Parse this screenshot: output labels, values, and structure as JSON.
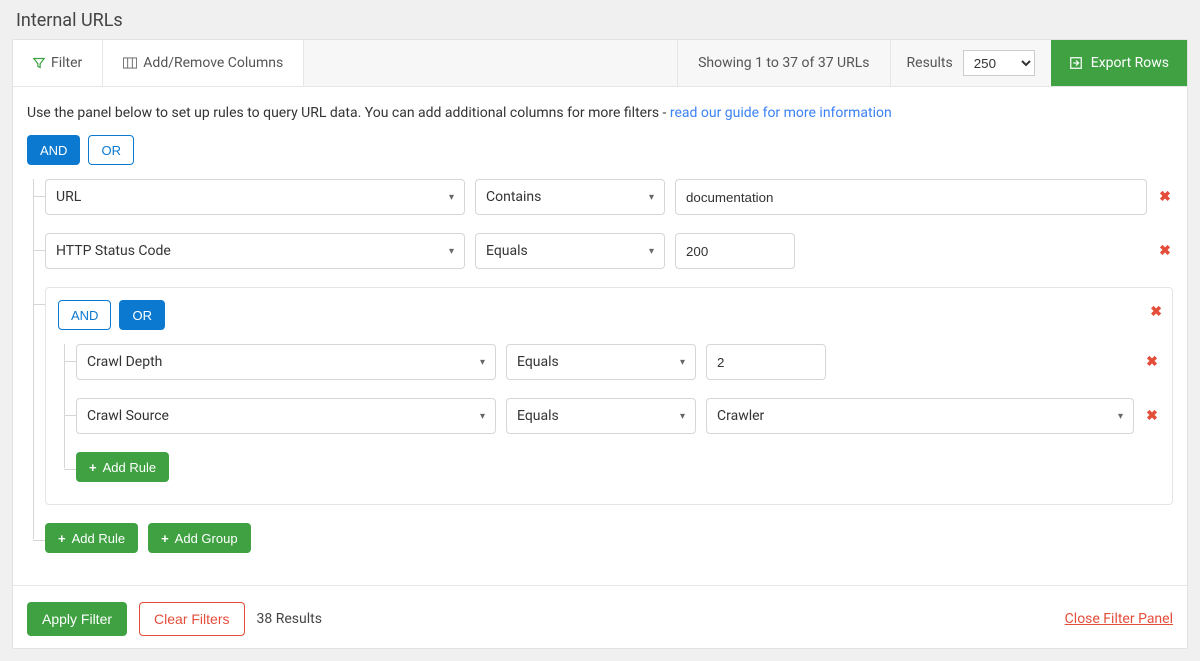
{
  "page": {
    "title": "Internal URLs"
  },
  "toolbar": {
    "filter_label": "Filter",
    "columns_label": "Add/Remove Columns",
    "showing_text": "Showing 1 to 37 of 37 URLs",
    "results_label": "Results",
    "results_value": "250",
    "export_label": "Export Rows"
  },
  "body": {
    "desc_prefix": "Use the panel below to set up rules to query URL data. You can add additional columns for more filters - ",
    "desc_link_text": "read our guide for more information",
    "root_and": "AND",
    "root_or": "OR",
    "add_rule_label": "Add Rule",
    "add_group_label": "Add Group"
  },
  "rules": {
    "r1": {
      "field": "URL",
      "operator": "Contains",
      "value": "documentation"
    },
    "r2": {
      "field": "HTTP Status Code",
      "operator": "Equals",
      "value": "200"
    }
  },
  "nested": {
    "and_label": "AND",
    "or_label": "OR",
    "r1": {
      "field": "Crawl Depth",
      "operator": "Equals",
      "value": "2"
    },
    "r2": {
      "field": "Crawl Source",
      "operator": "Equals",
      "value": "Crawler"
    },
    "add_rule_label": "Add Rule"
  },
  "footer": {
    "apply_label": "Apply Filter",
    "clear_label": "Clear Filters",
    "count_text": "38 Results",
    "close_link": "Close Filter Panel"
  }
}
